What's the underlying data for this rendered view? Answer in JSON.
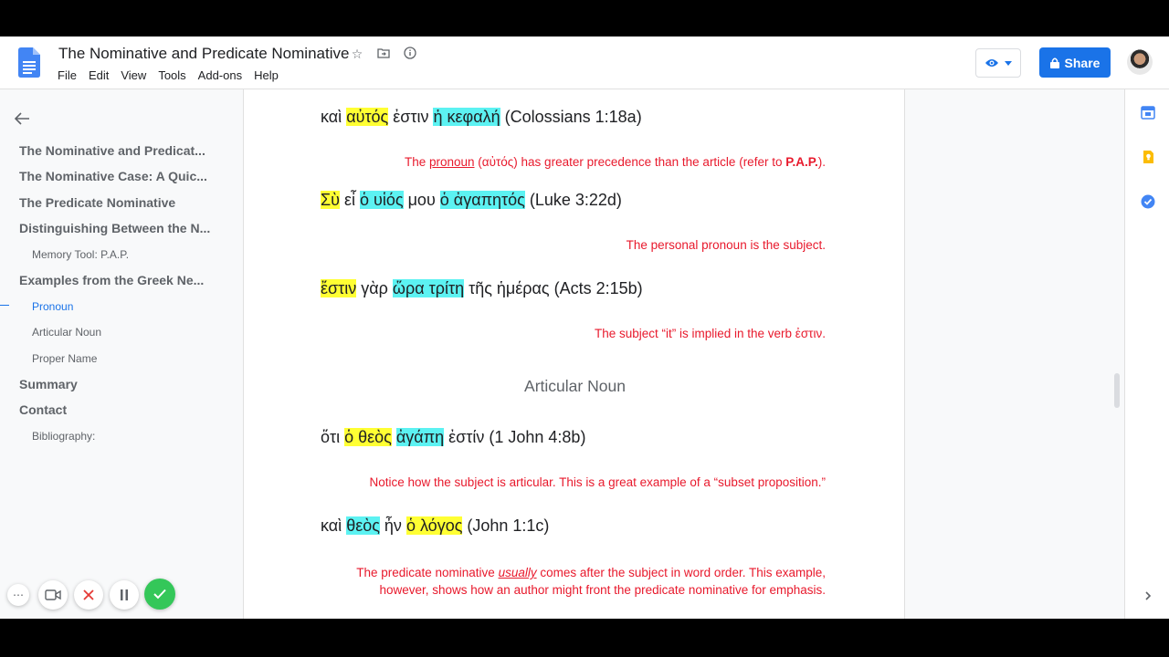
{
  "doc": {
    "title": "The Nominative and Predicate Nominative"
  },
  "menu": [
    "File",
    "Edit",
    "View",
    "Tools",
    "Add-ons",
    "Help"
  ],
  "share_label": "Share",
  "outline": {
    "items": [
      {
        "label": "The Nominative and Predicat...",
        "level": 1
      },
      {
        "label": "The Nominative Case: A Quic...",
        "level": 1
      },
      {
        "label": "The Predicate Nominative",
        "level": 1
      },
      {
        "label": "Distinguishing Between the N...",
        "level": 1
      },
      {
        "label": "Memory Tool: P.A.P.",
        "level": 2
      },
      {
        "label": "Examples from the Greek Ne...",
        "level": 1
      },
      {
        "label": "Pronoun",
        "level": 2,
        "active": true
      },
      {
        "label": "Articular Noun",
        "level": 2
      },
      {
        "label": "Proper Name",
        "level": 2
      },
      {
        "label": "Summary",
        "level": 1
      },
      {
        "label": "Contact",
        "level": 1
      },
      {
        "label": "Bibliography:",
        "level": 2
      }
    ]
  },
  "content": {
    "l1": {
      "a": "καὶ ",
      "b": "αὐτός",
      "c": " ἐστιν ",
      "d": "ἡ κεφαλή",
      "e": " (Colossians 1:18a)"
    },
    "n1": {
      "a": "The ",
      "b": "pronoun",
      "c": " (αὐτός) has greater precedence than the article (refer to ",
      "d": "P.A.P.",
      "e": ")."
    },
    "l2": {
      "a": "Σὺ",
      "b": " εἶ ",
      "c": "ὁ υἱός",
      "d": " μου ",
      "e": "ὁ ἀγαπητός",
      "f": " (Luke 3:22d)"
    },
    "n2": "The personal pronoun is the subject.",
    "l3": {
      "a": "ἔστιν",
      "b": " γὰρ ",
      "c": "ὥρα τρίτη",
      "d": " τῆς ἡμέρας (Acts 2:15b)"
    },
    "n3": "The subject “it” is implied in the verb ἐστιν.",
    "heading": "Articular Noun",
    "l4": {
      "a": "ὅτι ",
      "b": "ὁ θεὸς",
      "c": " ",
      "d": "ἀγάπη",
      "e": " ἐστίν (1 John 4:8b)"
    },
    "n4": "Notice how the subject is articular. This is a great example of a “subset proposition.”",
    "l5": {
      "a": "καὶ ",
      "b": "θεὸς",
      "c": " ἦν ",
      "d": "ὁ λόγος",
      "e": " (John 1:1c)"
    },
    "n5": {
      "a": "The predicate nominative ",
      "b": "usually",
      "c": " comes after the subject in word order. This example,",
      "d": "however,  shows how an author might front the predicate nominative for emphasis."
    }
  },
  "colors": {
    "highlight_yellow": "#ffff33",
    "highlight_cyan": "#5cf2f2",
    "note_red": "#e8192c",
    "accent": "#1a73e8"
  }
}
